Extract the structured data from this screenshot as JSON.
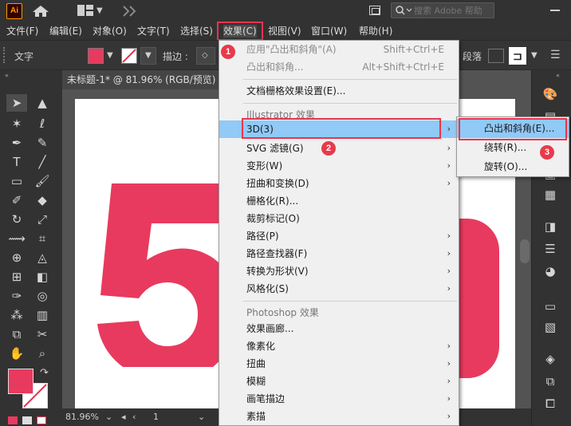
{
  "app": {
    "logo": "Ai"
  },
  "search": {
    "placeholder": "搜索 Adobe 帮助"
  },
  "menubar": {
    "items": [
      "文件(F)",
      "编辑(E)",
      "对象(O)",
      "文字(T)",
      "选择(S)",
      "效果(C)",
      "视图(V)",
      "窗口(W)",
      "帮助(H)"
    ]
  },
  "control": {
    "mode_label": "文字",
    "stroke_label": "描边 :",
    "paragraph_label": "段落"
  },
  "document": {
    "tab_title": "未标题-1* @ 81.96% (RGB/预览)",
    "big_glyph": "5",
    "fill_color": "#e83a5e"
  },
  "status": {
    "zoom": "81.96%",
    "page": "1"
  },
  "effect_menu": {
    "apply_last": {
      "label": "应用\"凸出和斜角\"(A)",
      "shortcut": "Shift+Ctrl+E"
    },
    "last_effect": {
      "label": "凸出和斜角...",
      "shortcut": "Alt+Shift+Ctrl+E"
    },
    "raster_settings": "文档栅格效果设置(E)...",
    "illustrator_section": "Illustrator 效果",
    "illustrator_items": [
      "3D(3)",
      "SVG 滤镜(G)",
      "变形(W)",
      "扭曲和变换(D)",
      "栅格化(R)...",
      "裁剪标记(O)",
      "路径(P)",
      "路径查找器(F)",
      "转换为形状(V)",
      "风格化(S)"
    ],
    "photoshop_section": "Photoshop 效果",
    "photoshop_items": [
      "效果画廊...",
      "像素化",
      "扭曲",
      "模糊",
      "画笔描边",
      "素描"
    ]
  },
  "submenu_3d": {
    "items": [
      "凸出和斜角(E)...",
      "绕转(R)...",
      "旋转(O)..."
    ]
  },
  "step_badges": [
    "1",
    "2",
    "3"
  ]
}
